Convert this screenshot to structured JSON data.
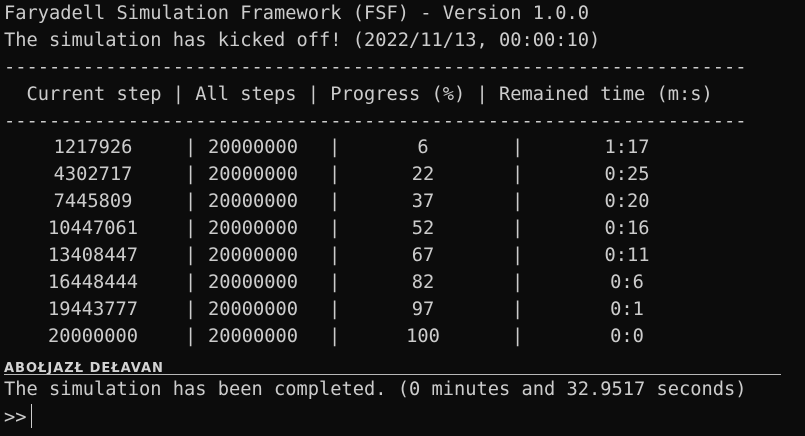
{
  "header": {
    "title_line": "Faryadell Simulation Framework (FSF) - Version 1.0.0",
    "status_line": "The simulation has kicked off! (2022/11/13, 00:00:10)"
  },
  "divider": "------------------------------------------------------------------",
  "table": {
    "header_line": "  Current step | All steps | Progress (%) | Remained time (m:s)",
    "separator": "|",
    "rows": [
      {
        "current": "1217926",
        "all": "20000000",
        "progress": "6",
        "remained": "1:17"
      },
      {
        "current": "4302717",
        "all": "20000000",
        "progress": "22",
        "remained": "0:25"
      },
      {
        "current": "7445809",
        "all": "20000000",
        "progress": "37",
        "remained": "0:20"
      },
      {
        "current": "10447061",
        "all": "20000000",
        "progress": "52",
        "remained": "0:16"
      },
      {
        "current": "13408447",
        "all": "20000000",
        "progress": "67",
        "remained": "0:11"
      },
      {
        "current": "16448444",
        "all": "20000000",
        "progress": "82",
        "remained": "0:6"
      },
      {
        "current": "19443777",
        "all": "20000000",
        "progress": "97",
        "remained": "0:1"
      },
      {
        "current": "20000000",
        "all": "20000000",
        "progress": "100",
        "remained": "0:0"
      }
    ]
  },
  "footer": {
    "logo_text": "ABOŁJAZŁ DEŁAVAN",
    "completed_line": "The simulation has been completed. (0 minutes and 32.9517 seconds)",
    "prompt": ">>"
  },
  "colors": {
    "background": "#0c0c0c",
    "foreground": "#cccccc"
  }
}
